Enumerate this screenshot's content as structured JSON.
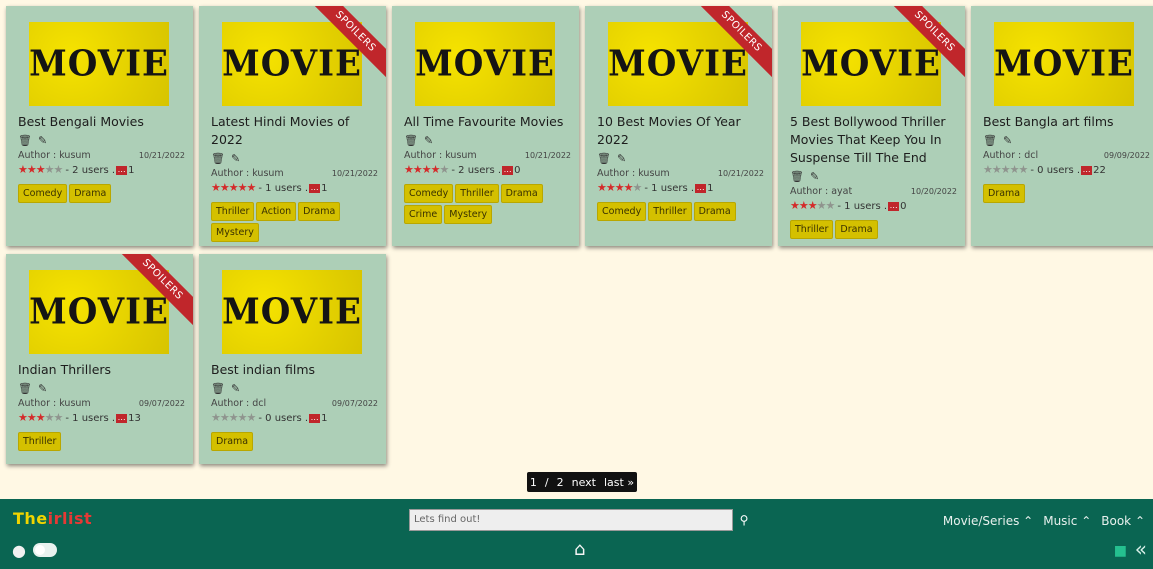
{
  "cards": [
    {
      "title": "Best Bengali Movies",
      "poster": "MOVIE",
      "spoiler": false,
      "author": "Author : kusum",
      "date": "10/21/2022",
      "rating": 3,
      "users": "- 2 users .",
      "comments": "1",
      "genres": [
        "Comedy",
        "Drama"
      ]
    },
    {
      "title": "Latest Hindi Movies of 2022",
      "poster": "MOVIE",
      "spoiler": true,
      "spoiler_label": "SPOILERS",
      "author": "Author : kusum",
      "date": "10/21/2022",
      "rating": 5,
      "users": "- 1 users .",
      "comments": "1",
      "genres": [
        "Thriller",
        "Action",
        "Drama",
        "Mystery"
      ]
    },
    {
      "title": "All Time Favourite Movies",
      "poster": "MOVIE",
      "spoiler": false,
      "author": "Author : kusum",
      "date": "10/21/2022",
      "rating": 4,
      "users": "- 2 users .",
      "comments": "0",
      "genres": [
        "Comedy",
        "Thriller",
        "Drama",
        "Crime",
        "Mystery"
      ]
    },
    {
      "title": "10 Best Movies Of Year 2022",
      "poster": "MOVIE",
      "spoiler": true,
      "spoiler_label": "SPOILERS",
      "author": "Author : kusum",
      "date": "10/21/2022",
      "rating": 4,
      "users": "- 1 users .",
      "comments": "1",
      "genres": [
        "Comedy",
        "Thriller",
        "Drama"
      ]
    },
    {
      "title": "5 Best Bollywood Thriller Movies That Keep You In Suspense Till The End",
      "poster": "MOVIE",
      "spoiler": true,
      "spoiler_label": "SPOILERS",
      "author": "Author : ayat",
      "date": "10/20/2022",
      "rating": 3,
      "users": "- 1 users .",
      "comments": "0",
      "genres": [
        "Thriller",
        "Drama"
      ]
    },
    {
      "title": "Best Bangla art films",
      "poster": "MOVIE",
      "spoiler": false,
      "author": "Author : dcl",
      "date": "09/09/2022",
      "rating": 0,
      "users": "- 0 users .",
      "comments": "22",
      "genres": [
        "Drama"
      ]
    },
    {
      "title": "Indian Thrillers",
      "poster": "MOVIE",
      "spoiler": true,
      "spoiler_label": "SPOILERS",
      "author": "Author : kusum",
      "date": "09/07/2022",
      "rating": 3,
      "users": "- 1 users .",
      "comments": "13",
      "genres": [
        "Thriller"
      ]
    },
    {
      "title": "Best indian films",
      "poster": "MOVIE",
      "spoiler": false,
      "author": "Author : dcl",
      "date": "09/07/2022",
      "rating": 0,
      "users": "- 0 users .",
      "comments": "1",
      "genres": [
        "Drama"
      ]
    }
  ],
  "pager": {
    "current": "1",
    "sep": "/",
    "total": "2",
    "next": "next",
    "last": "last »"
  },
  "footer": {
    "logo": "Theirlist",
    "search_placeholder": "Lets find out!",
    "menu": [
      "Movie/Series",
      "Music",
      "Book"
    ],
    "chevron": "^"
  }
}
